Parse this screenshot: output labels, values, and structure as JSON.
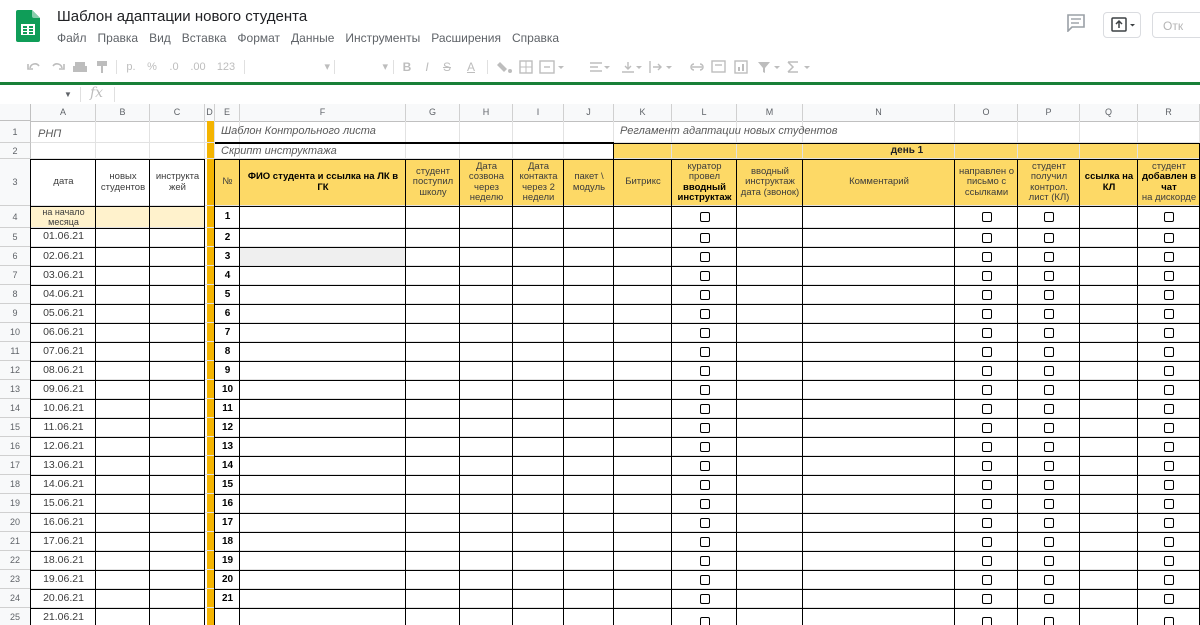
{
  "doc": {
    "title": "Шаблон адаптации нового студента",
    "menu": [
      "Файл",
      "Правка",
      "Вид",
      "Вставка",
      "Формат",
      "Данные",
      "Инструменты",
      "Расширения",
      "Справка"
    ],
    "share_label": "Отк"
  },
  "toolbar": {
    "currency": "р.",
    "percent": "%",
    "dec_less": ".0",
    "dec_more": ".00",
    "format_123": "123",
    "bold": "B",
    "italic": "I",
    "strike": "S",
    "text_color": "A"
  },
  "formula_bar": {
    "fx": "fx",
    "name_box": "",
    "value": ""
  },
  "columns": [
    "A",
    "B",
    "C",
    "D",
    "E",
    "F",
    "G",
    "H",
    "I",
    "J",
    "K",
    "L",
    "M",
    "N",
    "O",
    "P",
    "Q",
    "R"
  ],
  "row_numbers": [
    "1",
    "2",
    "3",
    "4",
    "5",
    "6",
    "7",
    "8",
    "9",
    "10",
    "11",
    "12",
    "13",
    "14",
    "15",
    "16",
    "17",
    "18",
    "19",
    "20",
    "21",
    "22",
    "23",
    "24",
    "25"
  ],
  "cells": {
    "a1": "РНП",
    "e1": "Шаблон Контрольного листа",
    "e2": "Скрипт инструктажа",
    "k1": "Регламент адаптации новых студентов",
    "day1": "день 1",
    "a3": "дата",
    "b3": "новых студентов",
    "c3": "инструкта жей",
    "e3": "№",
    "f3": "ФИО студента и ссылка на ЛК в ГК",
    "g3": "студент поступил школу",
    "h3": "Дата созвона через неделю",
    "i3": "Дата контакта через 2 недели",
    "j3": "пакет \\ модуль",
    "k3": "Битрикс",
    "l3_a": "куратор провел",
    "l3_b": "вводный инструктаж",
    "m3": "вводный инструктаж дата (звонок)",
    "n3": "Комментарий",
    "o3": "направлен о письмо с ссылками",
    "p3": "студент получил контрол. лист (КЛ)",
    "q3": "ссылка на КЛ",
    "r3_a": "студент",
    "r3_b": "добавлен в чат",
    "r3_c": "на дискорде",
    "a4": "на начало месяца"
  },
  "dates": [
    "01.06.21",
    "02.06.21",
    "03.06.21",
    "04.06.21",
    "05.06.21",
    "06.06.21",
    "07.06.21",
    "08.06.21",
    "09.06.21",
    "10.06.21",
    "11.06.21",
    "12.06.21",
    "13.06.21",
    "14.06.21",
    "15.06.21",
    "16.06.21",
    "17.06.21",
    "18.06.21",
    "19.06.21",
    "20.06.21",
    "21.06.21"
  ],
  "numbers": [
    "1",
    "2",
    "3",
    "4",
    "5",
    "6",
    "7",
    "8",
    "9",
    "10",
    "11",
    "12",
    "13",
    "14",
    "15",
    "16",
    "17",
    "18",
    "19",
    "20",
    "21"
  ],
  "colors": {
    "yellow": "#fdd966",
    "light_yellow": "#fff2cc",
    "orange": "#f4b400",
    "green": "#188038"
  }
}
